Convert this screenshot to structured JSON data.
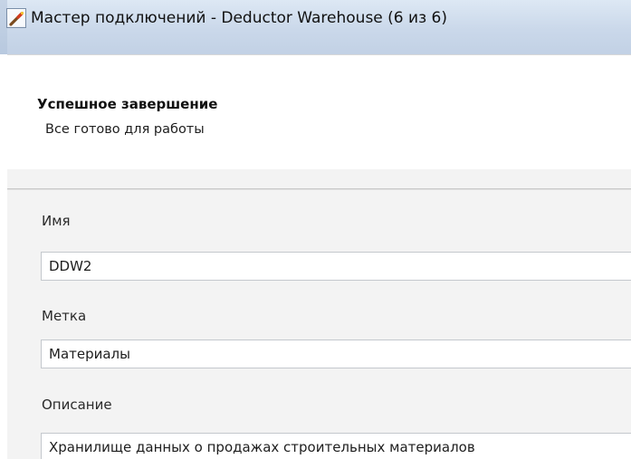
{
  "window": {
    "title": "Мастер подключений - Deductor Warehouse (6 из 6)"
  },
  "header": {
    "title": "Успешное завершение",
    "subtitle": "Все готово для работы"
  },
  "form": {
    "name_label": "Имя",
    "name_value": "DDW2",
    "tag_label": "Метка",
    "tag_value": "Материалы",
    "description_label": "Описание",
    "description_value": "Хранилище данных о продажах строительных материалов"
  },
  "icons": {
    "app": "wizard-wand-icon"
  }
}
